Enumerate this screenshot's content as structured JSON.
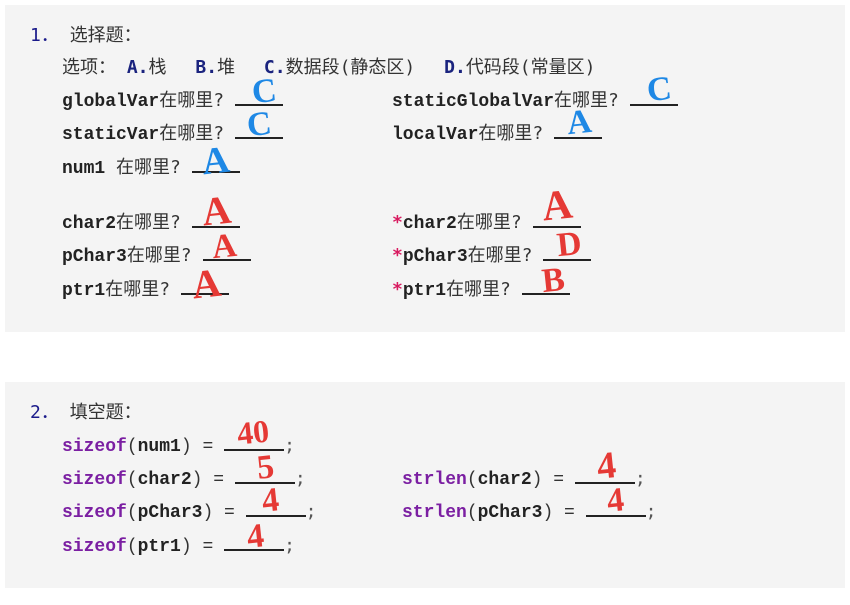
{
  "q1": {
    "number": "1．",
    "title": "选择题：",
    "options_label": "选项：",
    "opts": {
      "A_label": "A.",
      "A_text": "栈",
      "B_label": "B.",
      "B_text": "堆",
      "C_label": "C.",
      "C_text": "数据段(静态区)",
      "D_label": "D.",
      "D_text": "代码段(常量区)"
    },
    "qs": {
      "globalVar": {
        "var": "globalVar",
        "suffix": "在哪里?",
        "ans": "C"
      },
      "staticGlobalVar": {
        "var": "staticGlobalVar",
        "suffix": "在哪里?",
        "ans": "C"
      },
      "staticVar": {
        "var": "staticVar",
        "suffix": "在哪里?",
        "ans": "C"
      },
      "localVar": {
        "var": "localVar",
        "suffix": "在哪里?",
        "ans": "A"
      },
      "num1": {
        "var": "num1",
        "suffix": " 在哪里?",
        "ans": "A"
      },
      "char2": {
        "var": "char2",
        "suffix": "在哪里?",
        "ans": "A"
      },
      "star_char2": {
        "star": "*",
        "var": "char2",
        "suffix": "在哪里?",
        "ans": "A"
      },
      "pChar3": {
        "var": "pChar3",
        "suffix": "在哪里?",
        "ans": "A"
      },
      "star_pChar3": {
        "star": "*",
        "var": "pChar3",
        "suffix": "在哪里?",
        "ans": "D"
      },
      "ptr1": {
        "var": "ptr1",
        "suffix": "在哪里?",
        "ans": "A"
      },
      "star_ptr1": {
        "star": "*",
        "var": "ptr1",
        "suffix": "在哪里?",
        "ans": "B"
      }
    }
  },
  "q2": {
    "number": "2．",
    "title": "填空题：",
    "items": {
      "sizeof_num1": {
        "fn": "sizeof",
        "arg": "num1",
        "ans": "40"
      },
      "sizeof_char2": {
        "fn": "sizeof",
        "arg": "char2",
        "ans": "5"
      },
      "strlen_char2": {
        "fn": "strlen",
        "arg": "char2",
        "ans": "4"
      },
      "sizeof_pChar3": {
        "fn": "sizeof",
        "arg": "pChar3",
        "ans": "4"
      },
      "strlen_pChar3": {
        "fn": "strlen",
        "arg": "pChar3",
        "ans": "4"
      },
      "sizeof_ptr1": {
        "fn": "sizeof",
        "arg": "ptr1",
        "ans": "4"
      }
    }
  }
}
